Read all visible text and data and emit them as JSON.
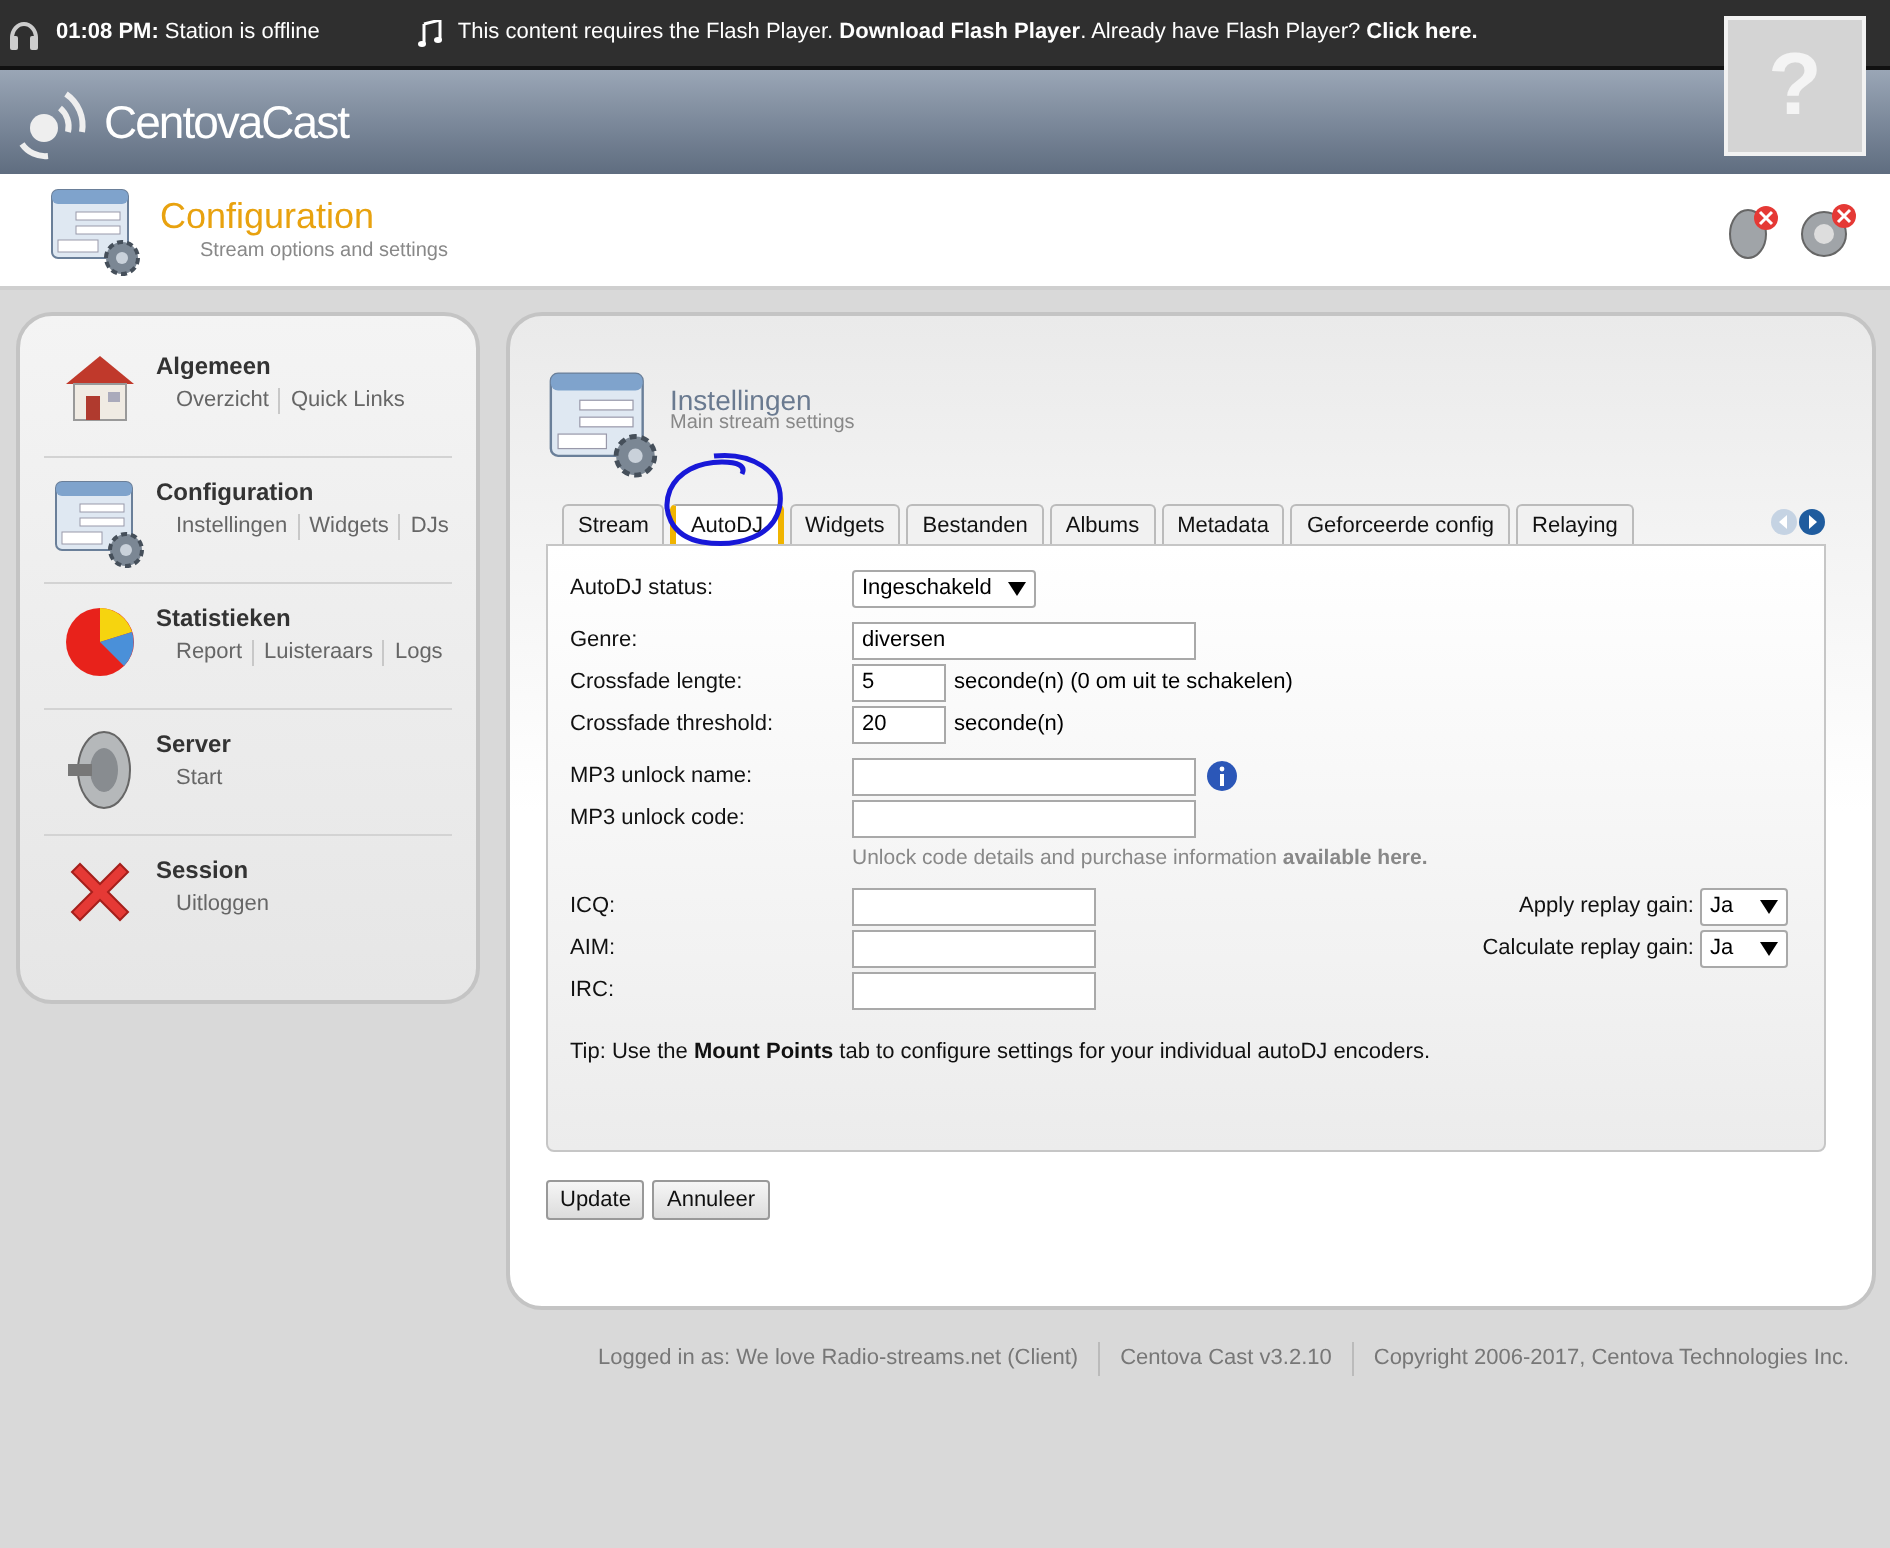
{
  "top_bar": {
    "time": "01:08 PM:",
    "status": "Station is offline",
    "flash_notice": "This content requires the Flash Player. **Download Flash Player**. Already have Flash Player? **Click here.**",
    "plugin_placeholder": "?"
  },
  "header": {
    "logo": "CentovaCast"
  },
  "page_title": {
    "title": "Configuration",
    "subtitle": "Stream options and settings"
  },
  "sidebar": {
    "sections": [
      {
        "title": "Algemeen",
        "kind": "house",
        "links": [
          "Overzicht",
          "Quick Links"
        ]
      },
      {
        "title": "Configuration",
        "kind": "config",
        "links": [
          "Instellingen",
          "Widgets",
          "DJs"
        ]
      },
      {
        "title": "Statistieken",
        "kind": "pie",
        "links": [
          "Report",
          "Luisteraars",
          "Logs"
        ]
      },
      {
        "title": "Server",
        "kind": "speaker",
        "links": [
          "Start"
        ]
      },
      {
        "title": "Session",
        "kind": "cross",
        "links": [
          "Uitloggen"
        ]
      }
    ]
  },
  "panel": {
    "title": "Instellingen",
    "subtitle": "Main stream settings",
    "tabs": [
      {
        "label": "Stream",
        "selected": false
      },
      {
        "label": "AutoDJ",
        "selected": true
      },
      {
        "label": "Widgets",
        "selected": false
      },
      {
        "label": "Bestanden",
        "selected": false
      },
      {
        "label": "Albums",
        "selected": false
      },
      {
        "label": "Metadata",
        "selected": false
      },
      {
        "label": "Geforceerde config",
        "selected": false
      },
      {
        "label": "Relaying",
        "selected": false
      }
    ],
    "status": {
      "label": "AutoDJ status:",
      "value": "Ingeschakeld"
    },
    "genre": {
      "label": "Genre:",
      "value": "diversen"
    },
    "crossfade_length": {
      "label": "Crossfade lengte:",
      "value": "5",
      "unit": "seconde(n) (0 om uit te schakelen)"
    },
    "crossfade_threshold": {
      "label": "Crossfade threshold:",
      "value": "20",
      "unit": "seconde(n)"
    },
    "mp3_unlock_name": {
      "label": "MP3 unlock name:"
    },
    "mp3_unlock_code": {
      "label": "MP3 unlock code:"
    },
    "unlock_note": "Unlock code details and purchase information **available here.**",
    "contacts": [
      {
        "label": "ICQ:"
      },
      {
        "label": "AIM:"
      },
      {
        "label": "IRC:"
      }
    ],
    "replay_gain": [
      {
        "label": "Apply replay gain:",
        "value": "Ja"
      },
      {
        "label": "Calculate replay gain:",
        "value": "Ja"
      }
    ],
    "tip": "Tip: Use the **Mount Points** tab to configure settings for your individual autoDJ encoders.",
    "buttons": [
      "Update",
      "Annuleer"
    ]
  },
  "footer": [
    "Logged in as: We love Radio-streams.net (Client)",
    "Centova Cast v3.2.10",
    "Copyright 2006-2017, Centova Technologies Inc."
  ]
}
